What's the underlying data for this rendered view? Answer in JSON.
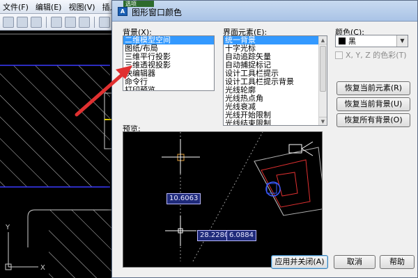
{
  "app": {
    "menu": [
      "文件(F)",
      "编辑(E)",
      "视图(V)",
      "插入"
    ],
    "axis_y": "Y",
    "axis_x": "X"
  },
  "dialog": {
    "title": "图形窗口颜色",
    "top_tab_label": "选项",
    "background_label": "背景(X):",
    "background_items": [
      "二维模型空间",
      "图纸/布局",
      "三维平行投影",
      "三维透视投影",
      "块编辑器",
      "命令行",
      "打印预览"
    ],
    "background_selected": 0,
    "element_label": "界面元素(E):",
    "element_items": [
      "统一背景",
      "十字光标",
      "自动追踪矢量",
      "自动捕捉标记",
      "设计工具栏提示",
      "设计工具栏提示背景",
      "光线轮廓",
      "光线热点角",
      "光线衰减",
      "光线开始限制",
      "光线结束限制",
      "相机轮廓颜色",
      "相机视野/平截面"
    ],
    "element_selected": 0,
    "color_label": "颜色(C):",
    "color_value": "黑",
    "tint_label": "X, Y, Z 的色彩(T)",
    "restore_element": "恢复当前元素(R)",
    "restore_context": "恢复当前背景(U)",
    "restore_all": "恢复所有背景(O)",
    "preview_label": "预览:",
    "readout_1": "10.6063",
    "readout_2": "28.2280",
    "readout_3": "6.0884",
    "apply_close": "应用并关闭(A)",
    "cancel": "取消",
    "help": "帮助"
  },
  "colors": {
    "selection": "#3399ff",
    "arrow": "#e03030",
    "preview_bg": "#000000"
  }
}
